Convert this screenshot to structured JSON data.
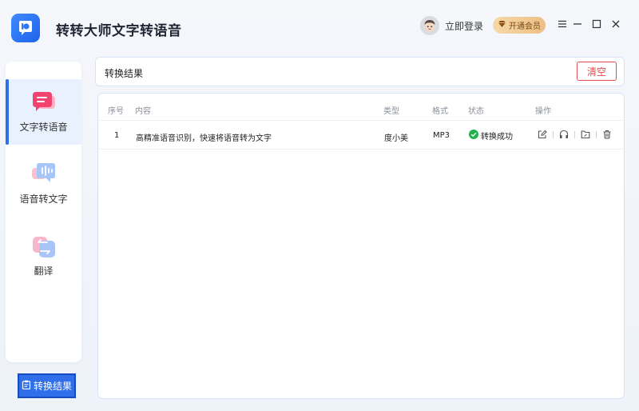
{
  "app": {
    "title": "转转大师文字转语音",
    "logo_icon": "app-logo-icon",
    "accent": "#2f6fe9"
  },
  "header": {
    "login_label": "立即登录",
    "vip_label": "开通会员",
    "controls": [
      "menu-icon",
      "minimize-icon",
      "maximize-icon",
      "close-icon"
    ]
  },
  "sidebar": {
    "items": [
      {
        "label": "文字转语音",
        "icon": "text-to-speech-icon",
        "active": true
      },
      {
        "label": "语音转文字",
        "icon": "speech-to-text-icon",
        "active": false
      },
      {
        "label": "翻译",
        "icon": "translate-icon",
        "active": false
      }
    ],
    "result_button": "转换结果"
  },
  "main": {
    "section_title": "转换结果",
    "clear_label": "清空",
    "columns": [
      "序号",
      "内容",
      "类型",
      "格式",
      "状态",
      "操作"
    ],
    "rows": [
      {
        "index": "1",
        "content": "高精准语音识别，快速将语音转为文字",
        "type": "度小美",
        "format": "MP3",
        "status": "转换成功",
        "status_color": "#22b14c",
        "actions": [
          "edit-icon",
          "headphones-icon",
          "folder-icon",
          "trash-icon"
        ]
      }
    ]
  }
}
